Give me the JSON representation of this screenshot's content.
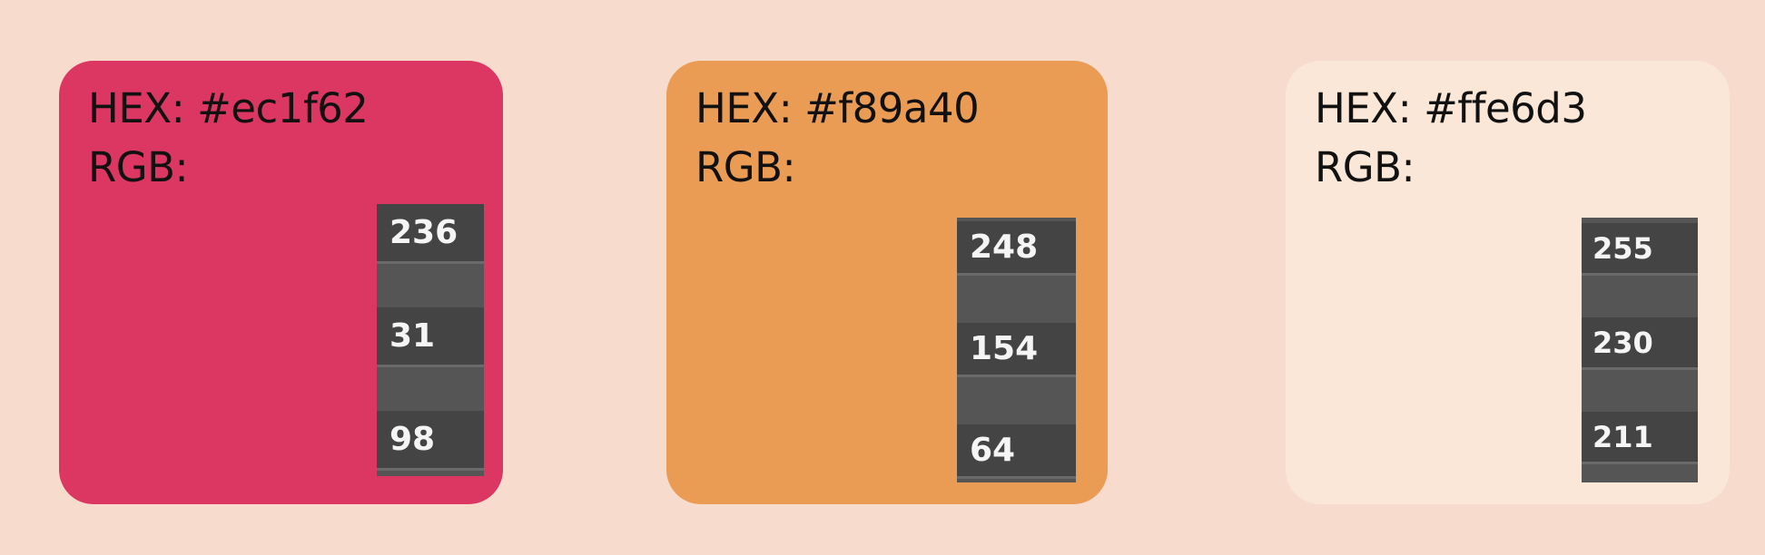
{
  "page": {
    "background": "#f7dbcd"
  },
  "cards": [
    {
      "color": "#dc3762",
      "hex_label": "HEX: #ec1f62",
      "rgb_label": "RGB:",
      "values": [
        "236",
        "31",
        "98"
      ]
    },
    {
      "color": "#ea9c55",
      "hex_label": "HEX: #f89a40",
      "rgb_label": "RGB:",
      "values": [
        "248",
        "154",
        "64"
      ]
    },
    {
      "color": "#fae7d7",
      "hex_label": "HEX: #ffe6d3",
      "rgb_label": "RGB:",
      "values": [
        "255",
        "230",
        "211"
      ]
    }
  ]
}
